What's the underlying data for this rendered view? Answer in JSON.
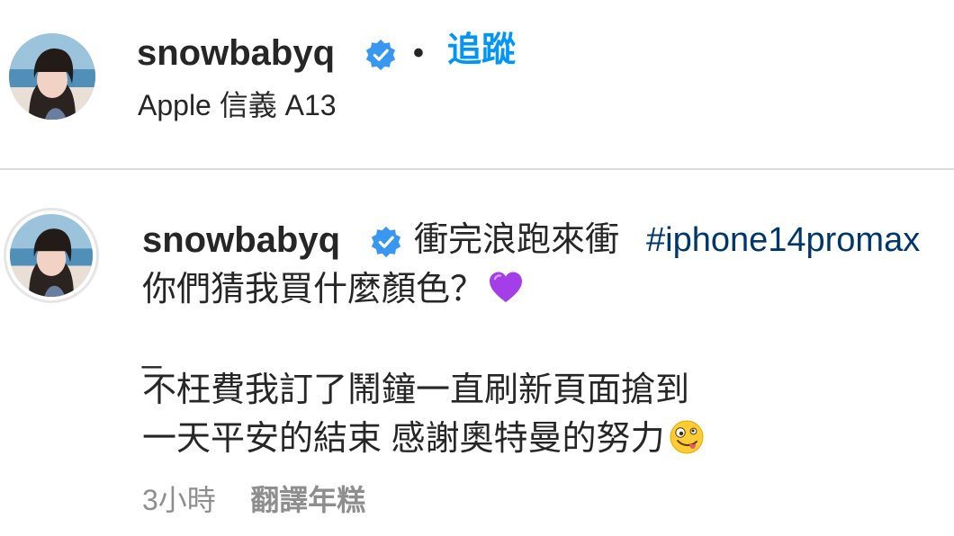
{
  "post_header": {
    "username": "snowbabyq",
    "verified_icon": "verified-badge-icon",
    "separator": "•",
    "follow_label": "追蹤",
    "location": "Apple 信義 A13"
  },
  "caption": {
    "username": "snowbabyq",
    "verified_icon": "verified-badge-icon",
    "line1_text": "衝完浪跑來衝",
    "hashtag": "#iphone14promax",
    "line2": "你們猜我買什麼顏色？",
    "line2_emoji": "purple-heart-emoji",
    "line3": "_",
    "line4": "不枉費我訂了鬧鐘一直刷新頁面搶到",
    "line5": "一天平安的結束 感謝奧特曼的努力",
    "line5_emoji": "zany-face-emoji"
  },
  "footer": {
    "timestamp": "3小時",
    "translate_label": "翻譯年糕"
  },
  "colors": {
    "text": "#262626",
    "link_blue": "#0095f6",
    "hashtag_blue": "#00376b",
    "muted": "#8e8e8e",
    "verified_blue": "#3897f0",
    "divider": "#dbdbdb"
  }
}
